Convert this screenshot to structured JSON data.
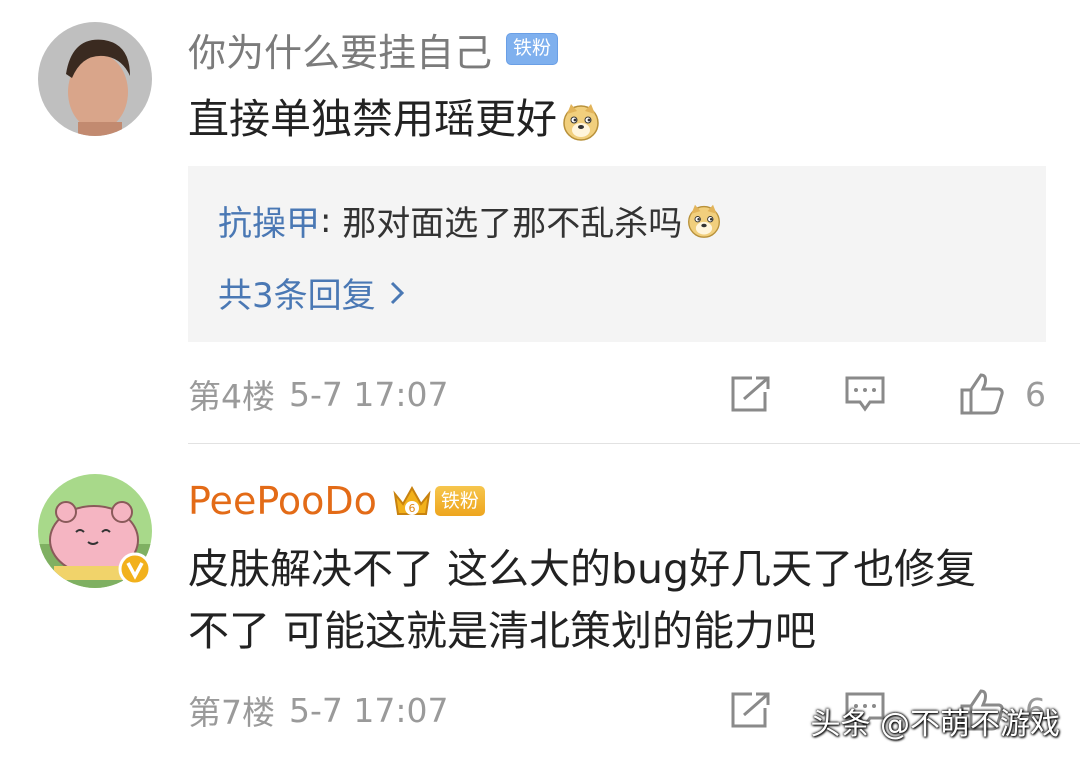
{
  "comments": [
    {
      "username": "你为什么要挂自己",
      "badge": "铁粉",
      "text": "直接单独禁用瑶更好",
      "emoji_icon": "doge-icon",
      "reply": {
        "author": "抗操甲",
        "separator": ": ",
        "text": "那对面选了那不乱杀吗",
        "emoji_icon": "doge-icon",
        "more_label": "共3条回复"
      },
      "floor": "第4楼",
      "time": "5-7 17:07",
      "likes": "6"
    },
    {
      "username": "PeePooDo",
      "badge_level": "6",
      "badge": "铁粉",
      "text_line1": "皮肤解决不了 这么大的bug好几天了也修复",
      "text_line2": "不了 可能这就是清北策划的能力吧",
      "floor": "第7楼",
      "time": "5-7 17:07",
      "likes": "6"
    }
  ],
  "watermark": "头条 @不萌不游戏",
  "colors": {
    "username_gray": "#7b7b7b",
    "username_orange": "#e36b17",
    "link_blue": "#4a78b4",
    "badge_blue": "#7fb0ee",
    "badge_gold": "#eea51e"
  }
}
